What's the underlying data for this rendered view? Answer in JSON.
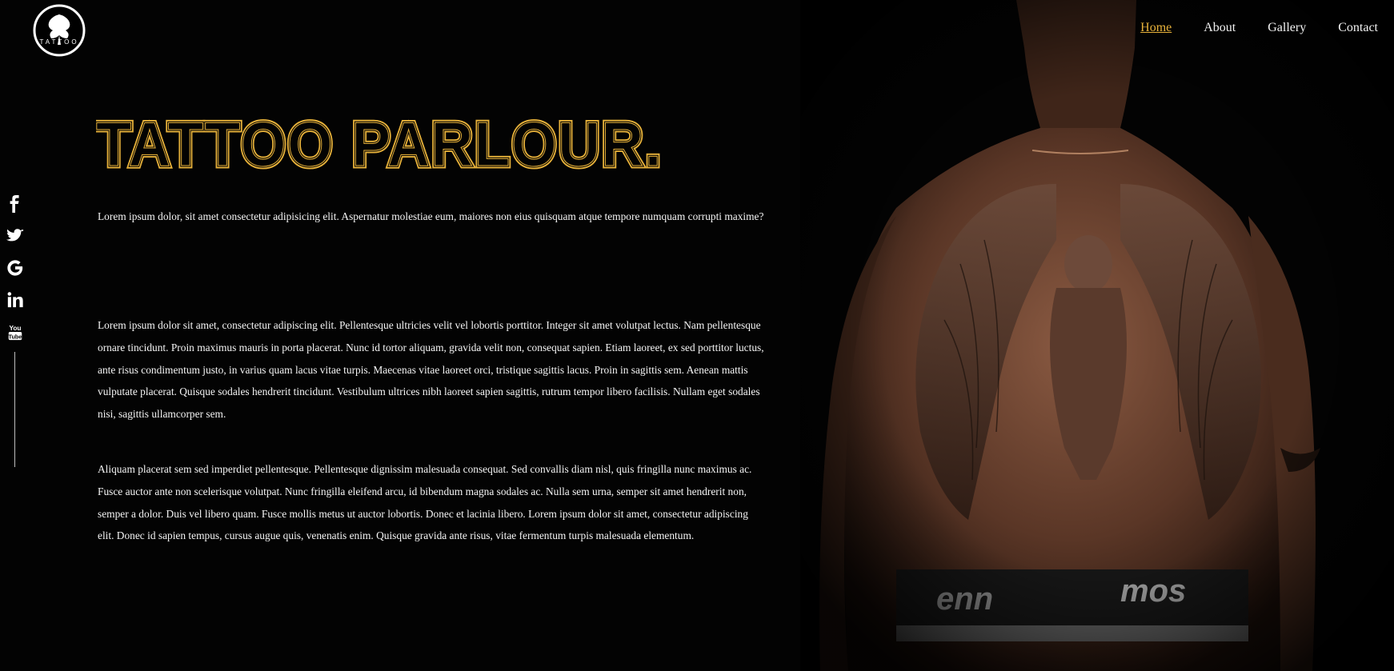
{
  "logo": {
    "text": "TATTOO"
  },
  "nav": {
    "items": [
      {
        "label": "Home",
        "active": true
      },
      {
        "label": "About",
        "active": false
      },
      {
        "label": "Gallery",
        "active": false
      },
      {
        "label": "Contact",
        "active": false
      }
    ]
  },
  "social": {
    "icons": [
      "facebook-icon",
      "twitter-icon",
      "google-icon",
      "linkedin-icon",
      "youtube-icon"
    ]
  },
  "hero": {
    "title": "TATTOO PARLOUR.",
    "paragraphs": [
      "Lorem ipsum dolor, sit amet consectetur adipisicing elit. Aspernatur molestiae eum, maiores non eius quisquam atque tempore numquam corrupti maxime?",
      "Lorem ipsum dolor sit amet, consectetur adipiscing elit. Pellentesque ultricies velit vel lobortis porttitor. Integer sit amet volutpat lectus. Nam pellentesque ornare tincidunt. Proin maximus mauris in porta placerat. Nunc id tortor aliquam, gravida velit non, consequat sapien. Etiam laoreet, ex sed porttitor luctus, ante risus condimentum justo, in varius quam lacus vitae turpis. Maecenas vitae laoreet orci, tristique sagittis lacus. Proin in sagittis sem. Aenean mattis vulputate placerat. Quisque sodales hendrerit tincidunt. Vestibulum ultrices nibh laoreet sapien sagittis, rutrum tempor libero facilisis. Nullam eget sodales nisi, sagittis ullamcorper sem.",
      "Aliquam placerat sem sed imperdiet pellentesque. Pellentesque dignissim malesuada consequat. Sed convallis diam nisl, quis fringilla nunc maximus ac. Fusce auctor ante non scelerisque volutpat. Nunc fringilla eleifend arcu, id bibendum magna sodales ac. Nulla sem urna, semper sit amet hendrerit non, semper a dolor. Duis vel libero quam. Fusce mollis metus ut auctor lobortis. Donec et lacinia libero. Lorem ipsum dolor sit amet, consectetur adipiscing elit. Donec id sapien tempus, cursus augue quis, venenatis enim. Quisque gravida ante risus, vitae fermentum turpis malesuada elementum."
    ]
  },
  "colors": {
    "background": "#030303",
    "accent": "#e8b23a",
    "text": "#f4f4f4"
  }
}
